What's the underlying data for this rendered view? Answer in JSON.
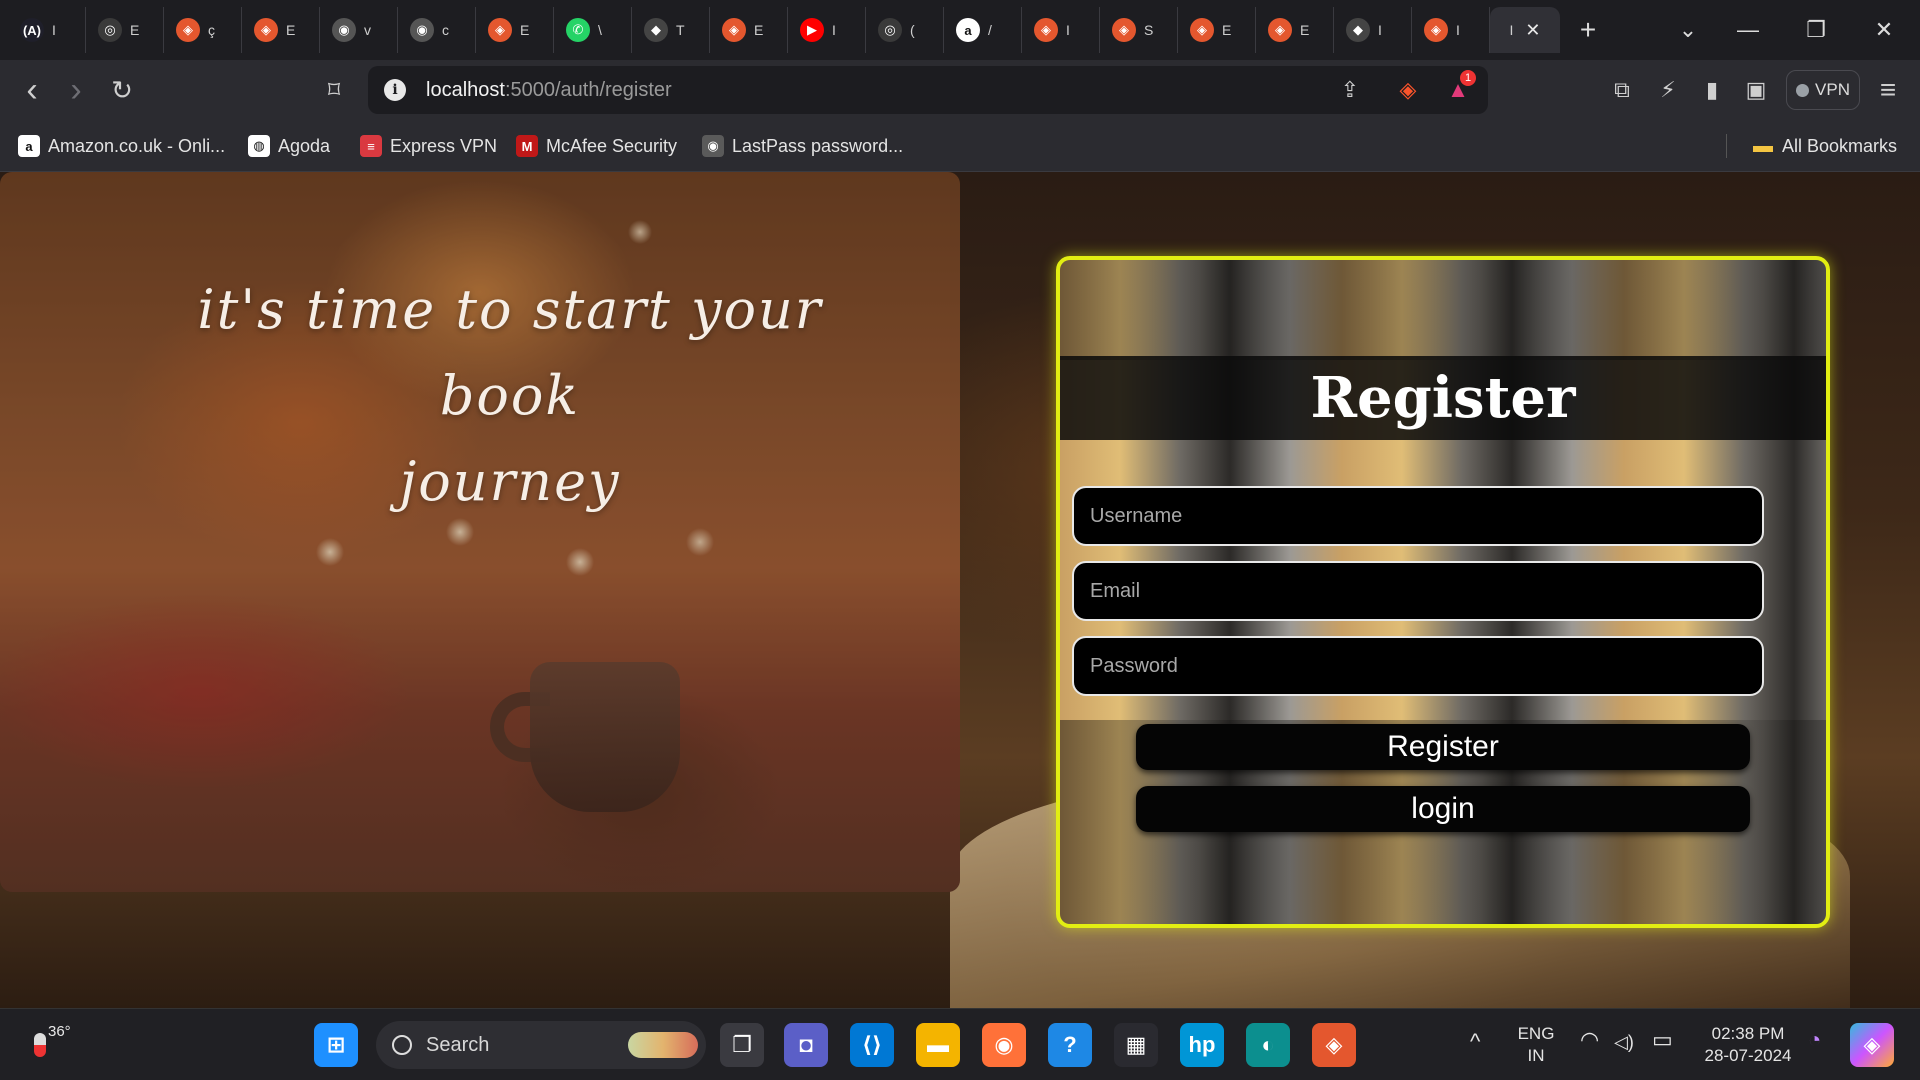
{
  "browser": {
    "tabs": [
      {
        "icon": "grammarly-icon",
        "glyph": "(A)",
        "title": "I",
        "color": "#1f1f2a"
      },
      {
        "icon": "chatgpt-icon",
        "glyph": "◎",
        "title": "E",
        "color": "#3a3a3a"
      },
      {
        "icon": "brave-icon",
        "glyph": "◈",
        "title": "ç",
        "color": "#e4572e"
      },
      {
        "icon": "brave-icon",
        "glyph": "◈",
        "title": "E",
        "color": "#e4572e"
      },
      {
        "icon": "globe-icon",
        "glyph": "◉",
        "title": "v",
        "color": "#555"
      },
      {
        "icon": "globe-icon",
        "glyph": "◉",
        "title": "c",
        "color": "#555"
      },
      {
        "icon": "brave-icon",
        "glyph": "◈",
        "title": "E",
        "color": "#e4572e"
      },
      {
        "icon": "whatsapp-icon",
        "glyph": "✆",
        "title": "\\",
        "color": "#25d366"
      },
      {
        "icon": "github-icon",
        "glyph": "◆",
        "title": "T",
        "color": "#444"
      },
      {
        "icon": "brave-icon",
        "glyph": "◈",
        "title": "E",
        "color": "#e4572e"
      },
      {
        "icon": "youtube-icon",
        "glyph": "▶",
        "title": "I",
        "color": "#ff0000"
      },
      {
        "icon": "chatgpt-icon",
        "glyph": "◎",
        "title": "(",
        "color": "#3a3a3a"
      },
      {
        "icon": "amazon-icon",
        "glyph": "a",
        "title": "/",
        "color": "#ffffff"
      },
      {
        "icon": "brave-icon",
        "glyph": "◈",
        "title": "I",
        "color": "#e4572e"
      },
      {
        "icon": "brave-icon",
        "glyph": "◈",
        "title": "S",
        "color": "#e4572e"
      },
      {
        "icon": "brave-icon",
        "glyph": "◈",
        "title": "E",
        "color": "#e4572e"
      },
      {
        "icon": "brave-icon",
        "glyph": "◈",
        "title": "E",
        "color": "#e4572e"
      },
      {
        "icon": "github-icon",
        "glyph": "◆",
        "title": "I",
        "color": "#444"
      },
      {
        "icon": "brave-icon",
        "glyph": "◈",
        "title": "I",
        "color": "#e4572e"
      }
    ],
    "active_tab_title": "I",
    "close_glyph": "✕",
    "new_tab_glyph": "+",
    "tab_search_glyph": "⌄",
    "window": {
      "minimize": "—",
      "restore": "❐",
      "close": "✕"
    },
    "nav": {
      "back": "‹",
      "forward": "›",
      "reload": "↻",
      "bookmark": "⌑"
    },
    "url": {
      "host": "localhost",
      "path": ":5000/auth/register",
      "info": "i"
    },
    "toolbar_right": {
      "share": "⇪",
      "brave_shield": "◈",
      "rewards": "▲",
      "rewards_badge": "1",
      "extensions": "⧉",
      "speedreader": "⚡",
      "sidebar": "▮",
      "wallet": "▣",
      "vpn_label": "VPN",
      "menu": "≡"
    },
    "bookmarks": [
      {
        "label": "Amazon.co.uk - Onli...",
        "icon": "amazon-icon",
        "glyph": "a",
        "bg": "#ffffff",
        "fg": "#111"
      },
      {
        "label": "Agoda",
        "icon": "agoda-icon",
        "glyph": "◍",
        "bg": "#ffffff",
        "fg": "#111"
      },
      {
        "label": "Express VPN",
        "icon": "expressvpn-icon",
        "glyph": "≡",
        "bg": "#da3940",
        "fg": "#fff"
      },
      {
        "label": "McAfee Security",
        "icon": "mcafee-icon",
        "glyph": "M",
        "bg": "#c01818",
        "fg": "#fff"
      },
      {
        "label": "LastPass password...",
        "icon": "globe-icon",
        "glyph": "◉",
        "bg": "#5a5a5a",
        "fg": "#fff"
      }
    ],
    "all_bookmarks": {
      "label": "All Bookmarks",
      "icon": "folder-icon",
      "glyph": "▬"
    }
  },
  "page": {
    "hero_line1": "it's time to start your book",
    "hero_line2": "journey",
    "form": {
      "title": "Register",
      "username_placeholder": "Username",
      "email_placeholder": "Email",
      "password_placeholder": "Password",
      "register_button": "Register",
      "login_button": "login"
    },
    "accent_color": "#e2ee12"
  },
  "taskbar": {
    "weather_temp": "36°",
    "search_label": "Search",
    "apps": [
      {
        "name": "start-icon",
        "glyph": "⊞",
        "bg": "#1e90ff"
      },
      {
        "name": "task-view-icon",
        "glyph": "❐",
        "bg": "#3a3a40"
      },
      {
        "name": "teams-icon",
        "glyph": "◘",
        "bg": "#5b5fc7"
      },
      {
        "name": "vscode-icon",
        "glyph": "⟨⟩",
        "bg": "#0078d4"
      },
      {
        "name": "file-explorer-icon",
        "glyph": "▬",
        "bg": "#f4b400"
      },
      {
        "name": "firefox-icon",
        "glyph": "◉",
        "bg": "#ff7139"
      },
      {
        "name": "get-help-icon",
        "glyph": "?",
        "bg": "#1e88e5"
      },
      {
        "name": "microsoft-store-icon",
        "glyph": "▦",
        "bg": "#2a2a30"
      },
      {
        "name": "myhp-icon",
        "glyph": "hp",
        "bg": "#0096d6"
      },
      {
        "name": "edge-icon",
        "glyph": "◐",
        "bg": "#0c8f8f"
      },
      {
        "name": "brave-taskbar-icon",
        "glyph": "◈",
        "bg": "#e4572e"
      }
    ],
    "tray": {
      "chevron": "^",
      "lang1": "ENG",
      "lang2": "IN",
      "wifi": "◠",
      "volume": "◁)",
      "battery": "▭",
      "time": "02:38 PM",
      "date": "28-07-2024",
      "notification": "◔",
      "copilot": "◈"
    }
  }
}
